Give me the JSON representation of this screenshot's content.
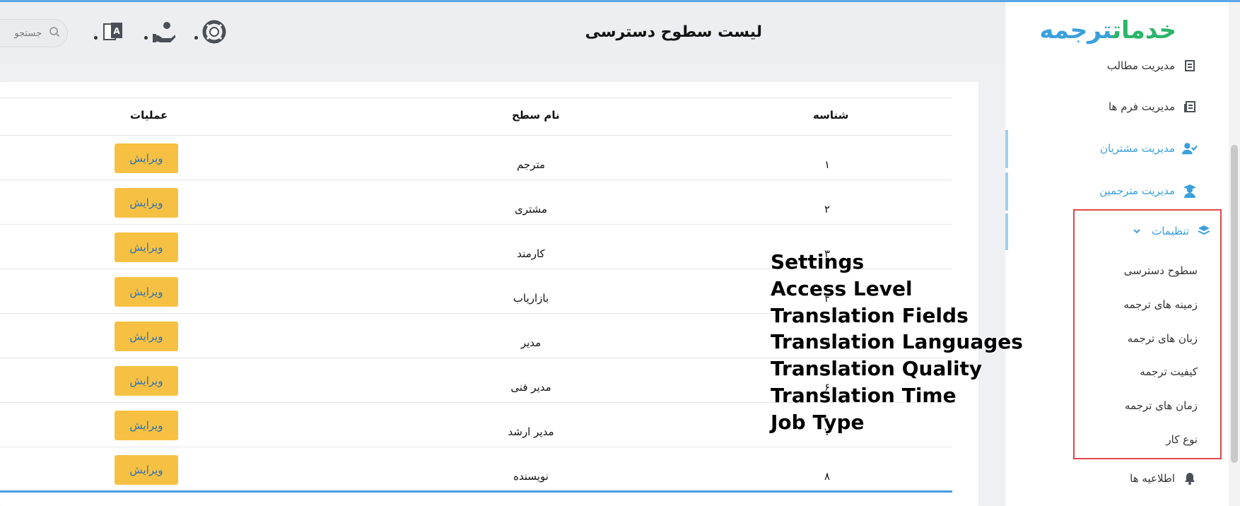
{
  "header": {
    "page_title": "لیست سطوح دسترسی",
    "search_placeholder": "جستجو"
  },
  "sidebar": {
    "logo_part1": "خدمات",
    "logo_part2": "ترجمه",
    "items": [
      {
        "label": "مدیریت مطالب"
      },
      {
        "label": "مدیریت فرم ها"
      },
      {
        "label": "مدیریت مشتریان"
      },
      {
        "label": "مدیریت مترجمین"
      },
      {
        "label": "تنظیمات"
      },
      {
        "label": "اطلاعیه ها"
      }
    ],
    "settings_submenu": [
      {
        "label": "سطوح دسترسی"
      },
      {
        "label": "زمینه های ترجمه"
      },
      {
        "label": "زبان های ترجمه"
      },
      {
        "label": "کیفیت ترجمه"
      },
      {
        "label": "زمان های ترجمه"
      },
      {
        "label": "نوع کار"
      }
    ]
  },
  "table": {
    "columns": {
      "id": "شناسه",
      "name": "نام سطح",
      "actions": "عملیات"
    },
    "edit_label": "ویرایش",
    "rows": [
      {
        "id": "۱",
        "name": "مترجم"
      },
      {
        "id": "۲",
        "name": "مشتری"
      },
      {
        "id": "۳",
        "name": "کارمند"
      },
      {
        "id": "۴",
        "name": "بازاریاب"
      },
      {
        "id": "۵",
        "name": "مدیر"
      },
      {
        "id": "۶",
        "name": "مدیر فنی"
      },
      {
        "id": "۷",
        "name": "مدیر ارشد"
      },
      {
        "id": "۸",
        "name": "نویسنده"
      }
    ]
  },
  "overlay": {
    "lines": [
      "Settings",
      "Access Level",
      "Translation Fields",
      "Translation Languages",
      "Translation Quality",
      "Translation Time",
      "Job Type"
    ]
  },
  "colors": {
    "accent_blue": "#3aa0dc",
    "logo_green": "#2ab56a",
    "edit_button": "#f6c142",
    "highlight_red": "#e0474c"
  }
}
